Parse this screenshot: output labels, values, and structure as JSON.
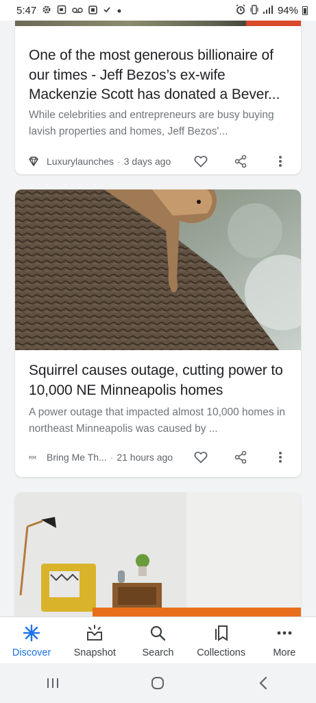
{
  "status_bar": {
    "time": "5:47",
    "battery": "94%",
    "icons": [
      "gear-icon",
      "screenshot-icon",
      "voicemail-icon",
      "square-icon",
      "check-icon",
      "dot-icon",
      "alarm-icon",
      "vibrate-icon",
      "signal-icon",
      "battery-icon"
    ]
  },
  "cards": [
    {
      "headline": "One of the most generous billionaire of our times - Jeff Bezos’s ex-wife Mackenzie Scott has donated a Bever...",
      "snippet": "While celebrities and entrepreneurs are busy buying lavish properties and homes, Jeff Bezos'...",
      "source": "Luxurylaunches",
      "separator": "·",
      "time_ago": "3 days ago"
    },
    {
      "headline": "Squirrel causes outage, cutting power to 10,000 NE Minneapolis homes",
      "snippet": "A power outage that impacted almost 10,000 homes in northeast Minneapolis was caused by ...",
      "source": "Bring Me Th...",
      "separator": "·",
      "time_ago": "21 hours ago"
    }
  ],
  "bottom_nav": [
    {
      "label": "Discover",
      "icon": "asterisk-icon",
      "active": true
    },
    {
      "label": "Snapshot",
      "icon": "snapshot-icon",
      "active": false
    },
    {
      "label": "Search",
      "icon": "search-icon",
      "active": false
    },
    {
      "label": "Collections",
      "icon": "collections-icon",
      "active": false
    },
    {
      "label": "More",
      "icon": "more-horiz-icon",
      "active": false
    }
  ],
  "colors": {
    "accent": "#1a73e8",
    "text": "#202124",
    "secondary": "#70757a",
    "background": "#f1f3f4"
  }
}
